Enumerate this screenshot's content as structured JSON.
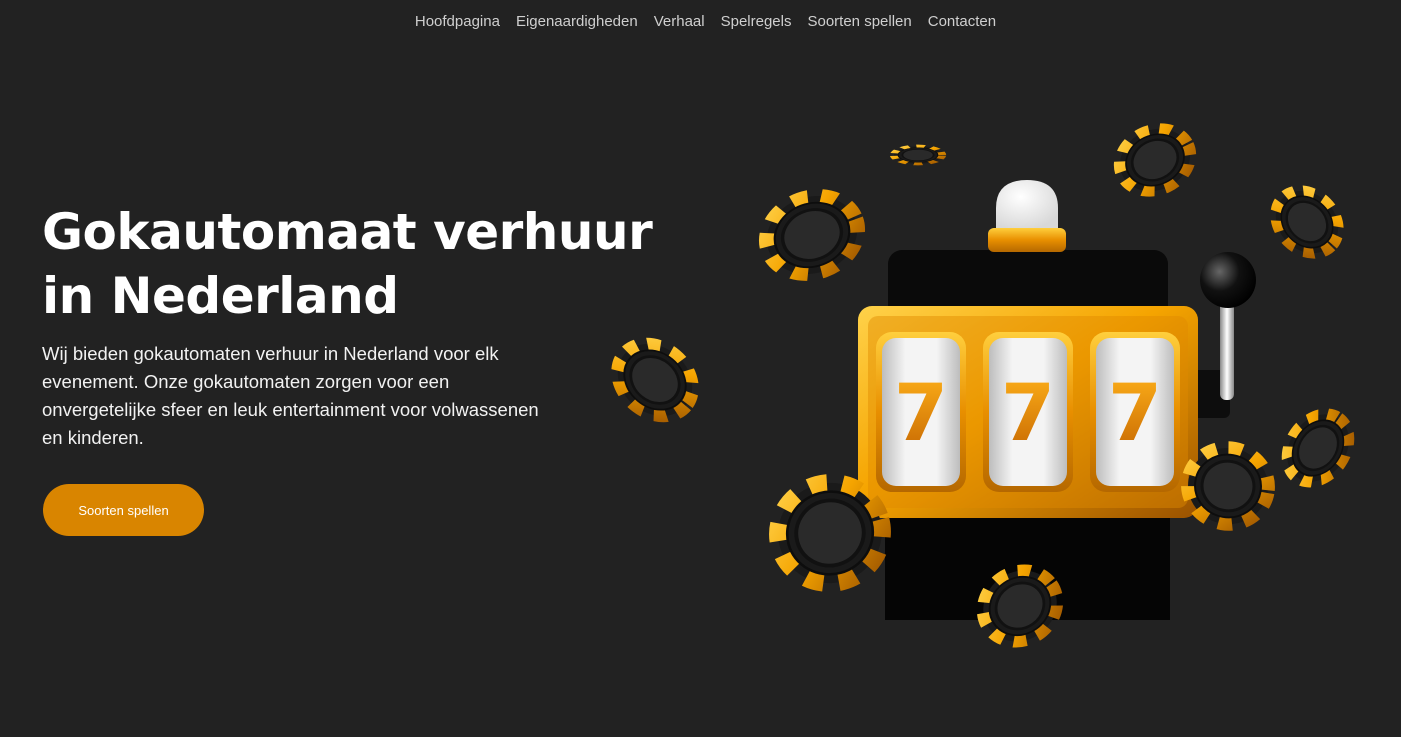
{
  "nav": {
    "items": [
      {
        "label": "Hoofdpagina"
      },
      {
        "label": "Eigenaardigheden"
      },
      {
        "label": "Verhaal"
      },
      {
        "label": "Spelregels"
      },
      {
        "label": "Soorten spellen"
      },
      {
        "label": "Contacten"
      }
    ]
  },
  "hero": {
    "title": "Gokautomaat verhuur in Nederland",
    "text": "Wij bieden gokautomaten verhuur in Nederland voor elk evenement. Onze gokautomaten zorgen voor een onvergetelijke sfeer en leuk entertainment voor volwassenen en kinderen.",
    "button_label": "Soorten spellen"
  },
  "illustration": {
    "icon": "slot-machine-with-casino-chips-illustration",
    "reels": [
      "7",
      "7",
      "7"
    ]
  },
  "colors": {
    "background": "#222222",
    "accent": "#d98500",
    "gold": "#f5a400",
    "nav_text": "#cfcfcf"
  }
}
